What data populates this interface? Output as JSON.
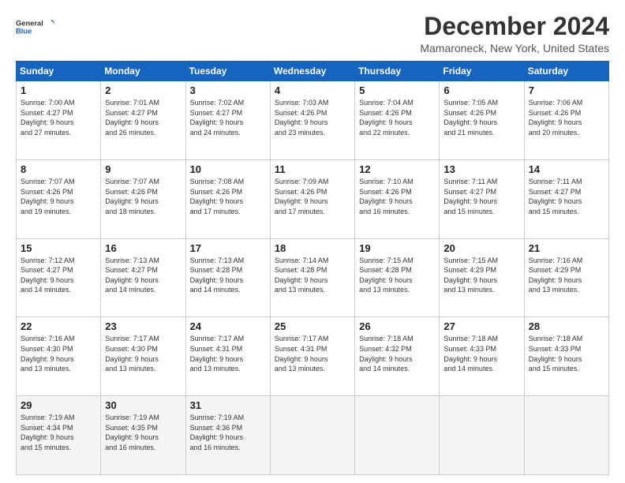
{
  "header": {
    "logo_line1": "General",
    "logo_line2": "Blue",
    "main_title": "December 2024",
    "subtitle": "Mamaroneck, New York, United States"
  },
  "calendar": {
    "days_of_week": [
      "Sunday",
      "Monday",
      "Tuesday",
      "Wednesday",
      "Thursday",
      "Friday",
      "Saturday"
    ],
    "weeks": [
      [
        {
          "day": "1",
          "info": "Sunrise: 7:00 AM\nSunset: 4:27 PM\nDaylight: 9 hours\nand 27 minutes."
        },
        {
          "day": "2",
          "info": "Sunrise: 7:01 AM\nSunset: 4:27 PM\nDaylight: 9 hours\nand 26 minutes."
        },
        {
          "day": "3",
          "info": "Sunrise: 7:02 AM\nSunset: 4:27 PM\nDaylight: 9 hours\nand 24 minutes."
        },
        {
          "day": "4",
          "info": "Sunrise: 7:03 AM\nSunset: 4:26 PM\nDaylight: 9 hours\nand 23 minutes."
        },
        {
          "day": "5",
          "info": "Sunrise: 7:04 AM\nSunset: 4:26 PM\nDaylight: 9 hours\nand 22 minutes."
        },
        {
          "day": "6",
          "info": "Sunrise: 7:05 AM\nSunset: 4:26 PM\nDaylight: 9 hours\nand 21 minutes."
        },
        {
          "day": "7",
          "info": "Sunrise: 7:06 AM\nSunset: 4:26 PM\nDaylight: 9 hours\nand 20 minutes."
        }
      ],
      [
        {
          "day": "8",
          "info": "Sunrise: 7:07 AM\nSunset: 4:26 PM\nDaylight: 9 hours\nand 19 minutes."
        },
        {
          "day": "9",
          "info": "Sunrise: 7:07 AM\nSunset: 4:26 PM\nDaylight: 9 hours\nand 18 minutes."
        },
        {
          "day": "10",
          "info": "Sunrise: 7:08 AM\nSunset: 4:26 PM\nDaylight: 9 hours\nand 17 minutes."
        },
        {
          "day": "11",
          "info": "Sunrise: 7:09 AM\nSunset: 4:26 PM\nDaylight: 9 hours\nand 17 minutes."
        },
        {
          "day": "12",
          "info": "Sunrise: 7:10 AM\nSunset: 4:26 PM\nDaylight: 9 hours\nand 16 minutes."
        },
        {
          "day": "13",
          "info": "Sunrise: 7:11 AM\nSunset: 4:27 PM\nDaylight: 9 hours\nand 15 minutes."
        },
        {
          "day": "14",
          "info": "Sunrise: 7:11 AM\nSunset: 4:27 PM\nDaylight: 9 hours\nand 15 minutes."
        }
      ],
      [
        {
          "day": "15",
          "info": "Sunrise: 7:12 AM\nSunset: 4:27 PM\nDaylight: 9 hours\nand 14 minutes."
        },
        {
          "day": "16",
          "info": "Sunrise: 7:13 AM\nSunset: 4:27 PM\nDaylight: 9 hours\nand 14 minutes."
        },
        {
          "day": "17",
          "info": "Sunrise: 7:13 AM\nSunset: 4:28 PM\nDaylight: 9 hours\nand 14 minutes."
        },
        {
          "day": "18",
          "info": "Sunrise: 7:14 AM\nSunset: 4:28 PM\nDaylight: 9 hours\nand 13 minutes."
        },
        {
          "day": "19",
          "info": "Sunrise: 7:15 AM\nSunset: 4:28 PM\nDaylight: 9 hours\nand 13 minutes."
        },
        {
          "day": "20",
          "info": "Sunrise: 7:15 AM\nSunset: 4:29 PM\nDaylight: 9 hours\nand 13 minutes."
        },
        {
          "day": "21",
          "info": "Sunrise: 7:16 AM\nSunset: 4:29 PM\nDaylight: 9 hours\nand 13 minutes."
        }
      ],
      [
        {
          "day": "22",
          "info": "Sunrise: 7:16 AM\nSunset: 4:30 PM\nDaylight: 9 hours\nand 13 minutes."
        },
        {
          "day": "23",
          "info": "Sunrise: 7:17 AM\nSunset: 4:30 PM\nDaylight: 9 hours\nand 13 minutes."
        },
        {
          "day": "24",
          "info": "Sunrise: 7:17 AM\nSunset: 4:31 PM\nDaylight: 9 hours\nand 13 minutes."
        },
        {
          "day": "25",
          "info": "Sunrise: 7:17 AM\nSunset: 4:31 PM\nDaylight: 9 hours\nand 13 minutes."
        },
        {
          "day": "26",
          "info": "Sunrise: 7:18 AM\nSunset: 4:32 PM\nDaylight: 9 hours\nand 14 minutes."
        },
        {
          "day": "27",
          "info": "Sunrise: 7:18 AM\nSunset: 4:33 PM\nDaylight: 9 hours\nand 14 minutes."
        },
        {
          "day": "28",
          "info": "Sunrise: 7:18 AM\nSunset: 4:33 PM\nDaylight: 9 hours\nand 15 minutes."
        }
      ],
      [
        {
          "day": "29",
          "info": "Sunrise: 7:19 AM\nSunset: 4:34 PM\nDaylight: 9 hours\nand 15 minutes."
        },
        {
          "day": "30",
          "info": "Sunrise: 7:19 AM\nSunset: 4:35 PM\nDaylight: 9 hours\nand 16 minutes."
        },
        {
          "day": "31",
          "info": "Sunrise: 7:19 AM\nSunset: 4:36 PM\nDaylight: 9 hours\nand 16 minutes."
        },
        {
          "day": "",
          "info": ""
        },
        {
          "day": "",
          "info": ""
        },
        {
          "day": "",
          "info": ""
        },
        {
          "day": "",
          "info": ""
        }
      ]
    ]
  }
}
